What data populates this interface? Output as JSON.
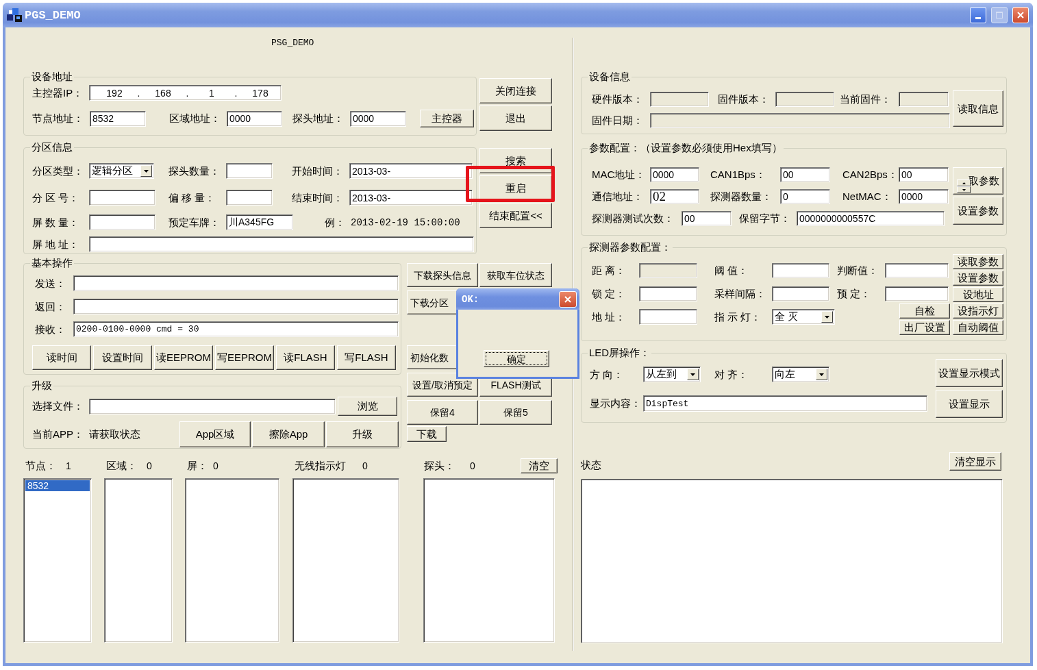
{
  "window": {
    "title": "PGS_DEMO",
    "heading": "PSG_DEMO"
  },
  "device_address": {
    "title": "设备地址",
    "ip_label": "主控器IP：",
    "ip_segments": [
      "192",
      "168",
      "1",
      "178"
    ],
    "ip_separator": ".",
    "fields": [
      {
        "label": "节点地址：",
        "value": "8532"
      },
      {
        "label": "区域地址：",
        "value": "0000"
      },
      {
        "label": "探头地址：",
        "value": "0000"
      }
    ],
    "button": "主控器"
  },
  "connection_buttons": [
    "关闭连接",
    "退出"
  ],
  "partition": {
    "title": "分区信息",
    "type_label": "分区类型：",
    "type_value": "逻辑分区",
    "probe_count_label": "探头数量：",
    "start_label": "开始时间：",
    "start_value": "2013-03-",
    "number_label": "分 区 号：",
    "offset_label": "偏 移 量：",
    "end_label": "结束时间：",
    "end_value": "2013-03-",
    "screen_count_label": "屏 数 量：",
    "plate_label": "预定车牌：",
    "plate_value": "川A345FG",
    "example_label": "例：",
    "example": "2013-02-19 15:00:00",
    "screen_address_label": "屏 地 址："
  },
  "config_buttons": [
    {
      "label": "搜索",
      "highlighted": false
    },
    {
      "label": "重启",
      "highlighted": true
    },
    {
      "label": "结束配置<<",
      "highlighted": false
    }
  ],
  "basic": {
    "title": "基本操作",
    "send_label": "发送：",
    "return_label": "返回：",
    "receive_label": "接收：",
    "receive_value": "0200-0100-0000 cmd = 30",
    "buttons": [
      "读时间",
      "设置时间",
      "读EEPROM",
      "写EEPROM",
      "读FLASH",
      "写FLASH"
    ]
  },
  "command_buttons": [
    {
      "label": "下载探头信息",
      "clipped": false
    },
    {
      "label": "获取车位状态",
      "clipped": false
    },
    {
      "label": "下载分区",
      "clipped": true
    },
    {
      "label": "初始化数",
      "clipped": true
    },
    {
      "label": "设置/取消预定",
      "clipped": false
    },
    {
      "label": "FLASH测试",
      "clipped": false
    },
    {
      "label": "保留4",
      "clipped": false
    },
    {
      "label": "保留5",
      "clipped": false
    }
  ],
  "download_button": "下载",
  "upgrade": {
    "title": "升级",
    "file_label": "选择文件：",
    "browse_button": "浏览",
    "app_label": "当前APP：",
    "app_status": "请获取状态",
    "buttons": [
      "App区域",
      "擦除App",
      "升级"
    ]
  },
  "lists": [
    {
      "label": "节点：",
      "count": "1",
      "items": [
        {
          "text": "8532",
          "selected": true
        }
      ]
    },
    {
      "label": "区域：",
      "count": "0"
    },
    {
      "label": "屏：",
      "count": "0"
    },
    {
      "label": "无线指示灯",
      "count": "0"
    },
    {
      "label": "探头：",
      "count": "0"
    }
  ],
  "clear_button": "清空",
  "device_info": {
    "title": "设备信息",
    "fields": [
      {
        "label": "硬件版本：",
        "disabled": true
      },
      {
        "label": "固件版本：",
        "disabled": true
      },
      {
        "label": "当前固件：",
        "disabled": true
      },
      {
        "label": "固件日期：",
        "disabled": true
      }
    ],
    "read_button": "读取信息"
  },
  "params": {
    "title": "参数配置：（设置参数必须使用Hex填写）",
    "fields": [
      {
        "label": "MAC地址：",
        "value": "0000"
      },
      {
        "label": "CAN1Bps：",
        "value": "00"
      },
      {
        "label": "CAN2Bps：",
        "value": "00"
      },
      {
        "label": "通信地址：",
        "value": "02"
      },
      {
        "label": "探测器数量：",
        "value": "0"
      },
      {
        "label": "NetMAC：",
        "value": "0000"
      },
      {
        "label": "探测器测试次数：",
        "value": "00"
      },
      {
        "label": "保留字节：",
        "value": "0000000000557C"
      }
    ],
    "read_button": "取参数",
    "set_button": "设置参数"
  },
  "detector": {
    "title": "探测器参数配置：",
    "fields": [
      {
        "label": "距 离：",
        "kind": "text",
        "disabled": true
      },
      {
        "label": "阈 值：",
        "kind": "text",
        "disabled": false
      },
      {
        "label": "判断值：",
        "kind": "text",
        "disabled": false
      },
      {
        "label": "锁 定：",
        "kind": "text",
        "disabled": false
      },
      {
        "label": "采样间隔：",
        "kind": "text",
        "disabled": false
      },
      {
        "label": "预 定：",
        "kind": "text",
        "disabled": false
      },
      {
        "label": "地 址：",
        "kind": "text",
        "disabled": false
      },
      {
        "label": "指 示 灯：",
        "kind": "dropdown",
        "value": "全 灭",
        "disabled": false
      }
    ],
    "buttons": [
      "读取参数",
      "设置参数",
      "设地址",
      "自检",
      "设指示灯",
      "出厂设置",
      "自动阈值"
    ]
  },
  "led": {
    "title": "LED屏操作：",
    "direction_label": "方 向：",
    "direction": "从左到",
    "align_label": "对 齐：",
    "align": "向左",
    "mode_button": "设置显示模式",
    "content_label": "显示内容：",
    "content": "DispTest",
    "show_button": "设置显示"
  },
  "status": {
    "label": "状态",
    "clear_button": "清空显示"
  },
  "dialog": {
    "title": "OK:",
    "button": "确定"
  }
}
